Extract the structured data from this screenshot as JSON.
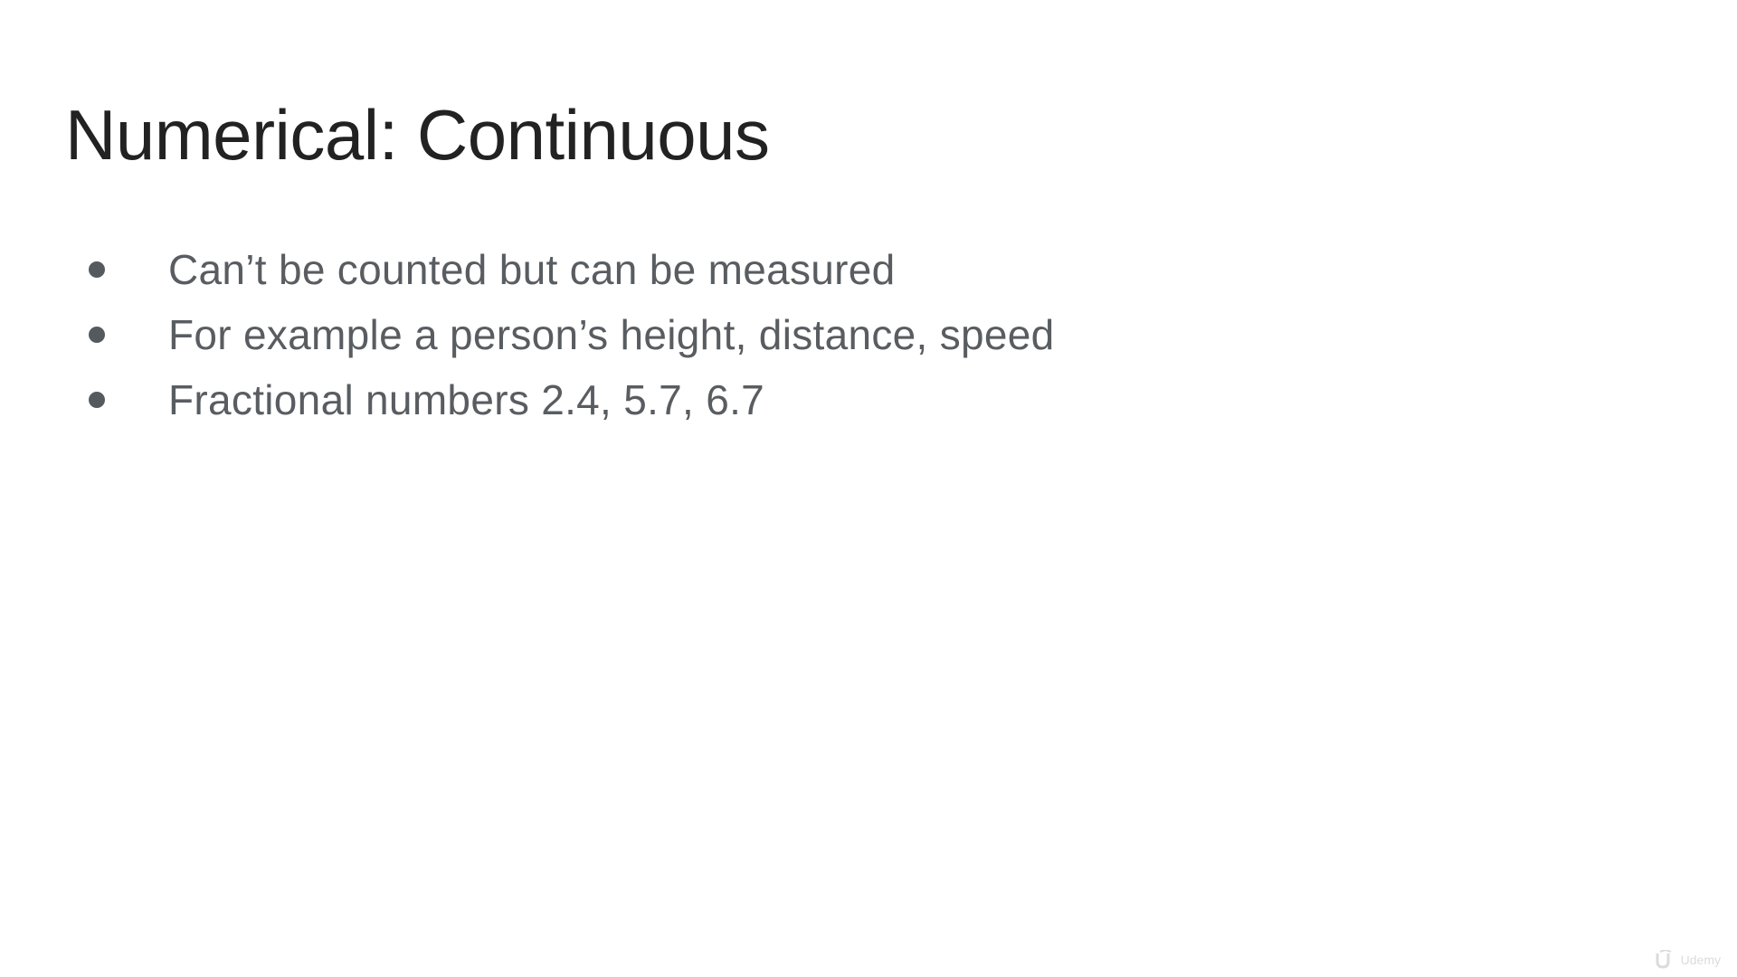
{
  "slide": {
    "title": "Numerical: Continuous",
    "bullets": [
      {
        "text": "Can’t be counted but can be measured"
      },
      {
        "text": "For example a person’s height, distance, speed"
      },
      {
        "text": "Fractional numbers 2.4, 5.7, 6.7"
      }
    ]
  },
  "watermark": {
    "text": "Udemy",
    "icon": "udemy-logo-icon"
  },
  "colors": {
    "background": "#ffffff",
    "title": "#222222",
    "body_text": "#595d61",
    "bullet": "#555a5e"
  }
}
